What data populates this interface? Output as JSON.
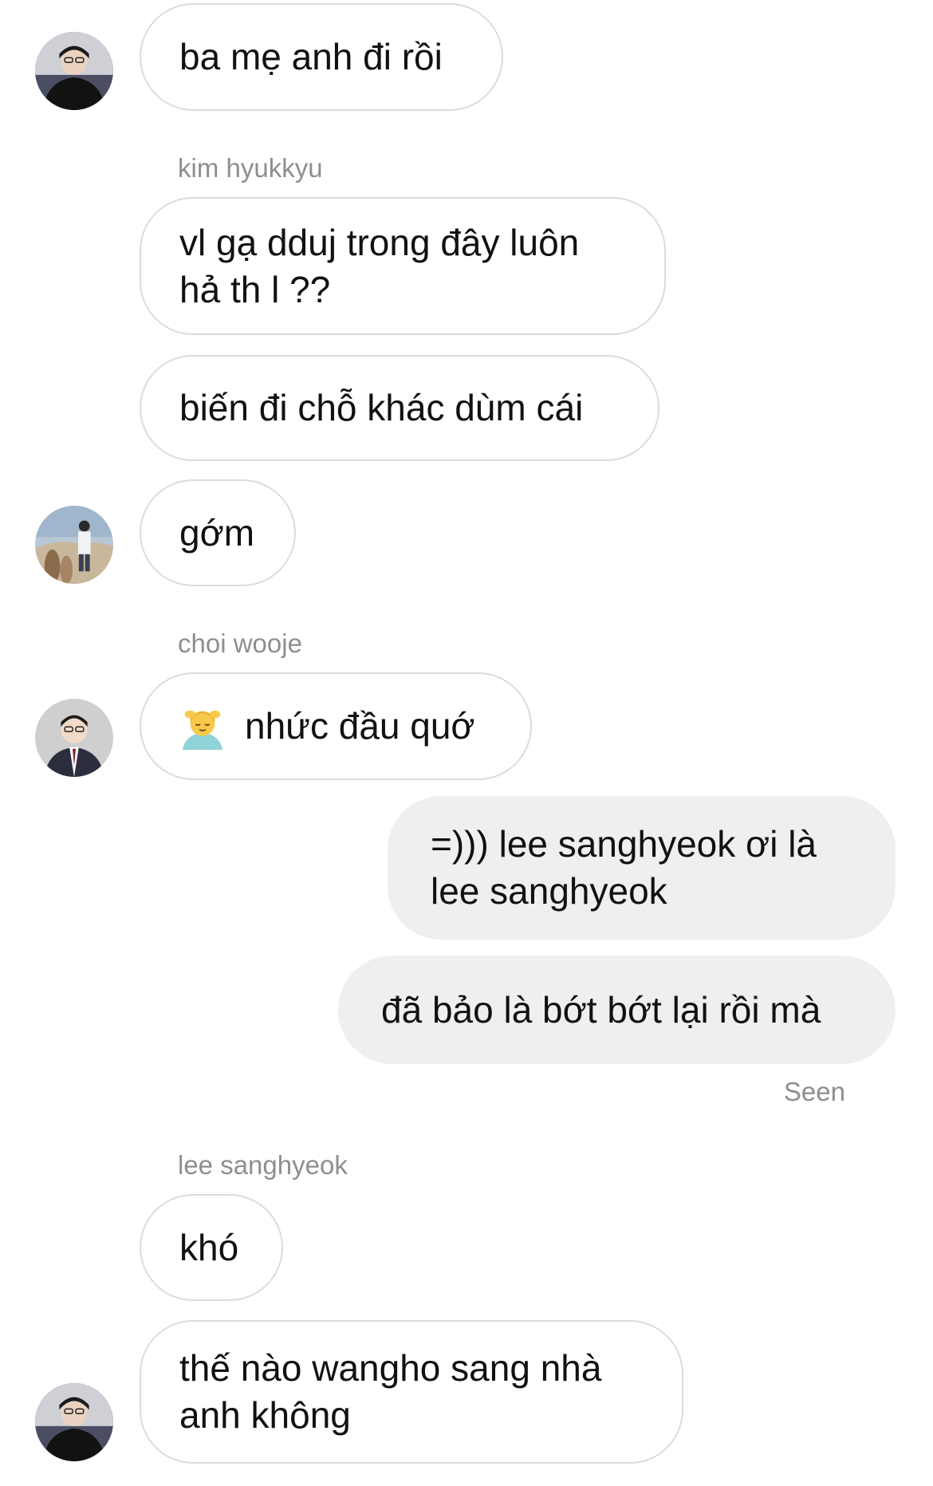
{
  "messages": [
    {
      "text": "ba mẹ anh đi rồi"
    },
    {
      "sender": "kim hyukkyu",
      "text": "vl gạ dduj trong đây luôn hả th l ??"
    },
    {
      "text": "biến đi chỗ khác dùm cái"
    },
    {
      "text": "gớm"
    },
    {
      "sender": "choi wooje",
      "text": "nhức đầu quớ",
      "emoji": "face-massage-emoji"
    },
    {
      "text": "=))) lee sanghyeok ơi là lee sanghyeok"
    },
    {
      "text": "đã bảo là bớt bớt lại rồi mà"
    },
    {
      "status": "Seen"
    },
    {
      "sender": "lee sanghyeok",
      "text": "khó"
    },
    {
      "text": "thế nào wangho sang nhà anh không"
    }
  ],
  "colors": {
    "incoming_bubble_bg": "#ffffff",
    "incoming_bubble_border": "#dcdcdc",
    "outgoing_bubble_bg": "#efefef",
    "meta_text": "#8e8e8e"
  }
}
